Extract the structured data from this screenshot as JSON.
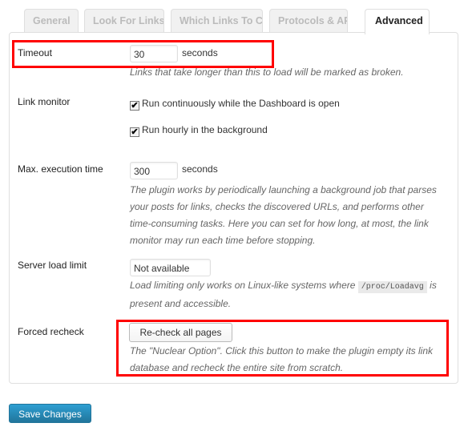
{
  "tabs": [
    {
      "label": "General",
      "active": false
    },
    {
      "label": "Look For Links In",
      "active": false
    },
    {
      "label": "Which Links To Check",
      "active": false
    },
    {
      "label": "Protocols & APIs",
      "active": false
    },
    {
      "label": "Advanced",
      "active": true
    }
  ],
  "settings": {
    "timeout": {
      "label": "Timeout",
      "value": "30",
      "unit": "seconds",
      "description": "Links that take longer than this to load will be marked as broken."
    },
    "link_monitor": {
      "label": "Link monitor",
      "options": [
        {
          "label": "Run continuously while the Dashboard is open",
          "checked": true
        },
        {
          "label": "Run hourly in the background",
          "checked": true
        }
      ]
    },
    "max_execution_time": {
      "label": "Max. execution time",
      "value": "300",
      "unit": "seconds",
      "description_lines": [
        "The plugin works by periodically launching a background job that parses",
        "your posts for links, checks the discovered URLs, and performs other",
        "time-consuming tasks. Here you can set for how long, at most, the link",
        "monitor may run each time before stopping."
      ]
    },
    "server_load_limit": {
      "label": "Server load limit",
      "value": "Not available",
      "description_pre": "Load limiting only works on Linux-like systems where ",
      "description_code": "/proc/Loadavg",
      "description_post": " is",
      "description_line2": "present and accessible."
    },
    "forced_recheck": {
      "label": "Forced recheck",
      "button_label": "Re-check all pages",
      "description_lines": [
        "The \"Nuclear Option\". Click this button to make the plugin empty its link",
        "database and recheck the entire site from scratch."
      ]
    }
  },
  "save_button_label": "Save Changes",
  "icons": {
    "checkbox_checked": "✔"
  },
  "colors": {
    "highlight": "#ff0000",
    "primary_button": "#21759b"
  }
}
